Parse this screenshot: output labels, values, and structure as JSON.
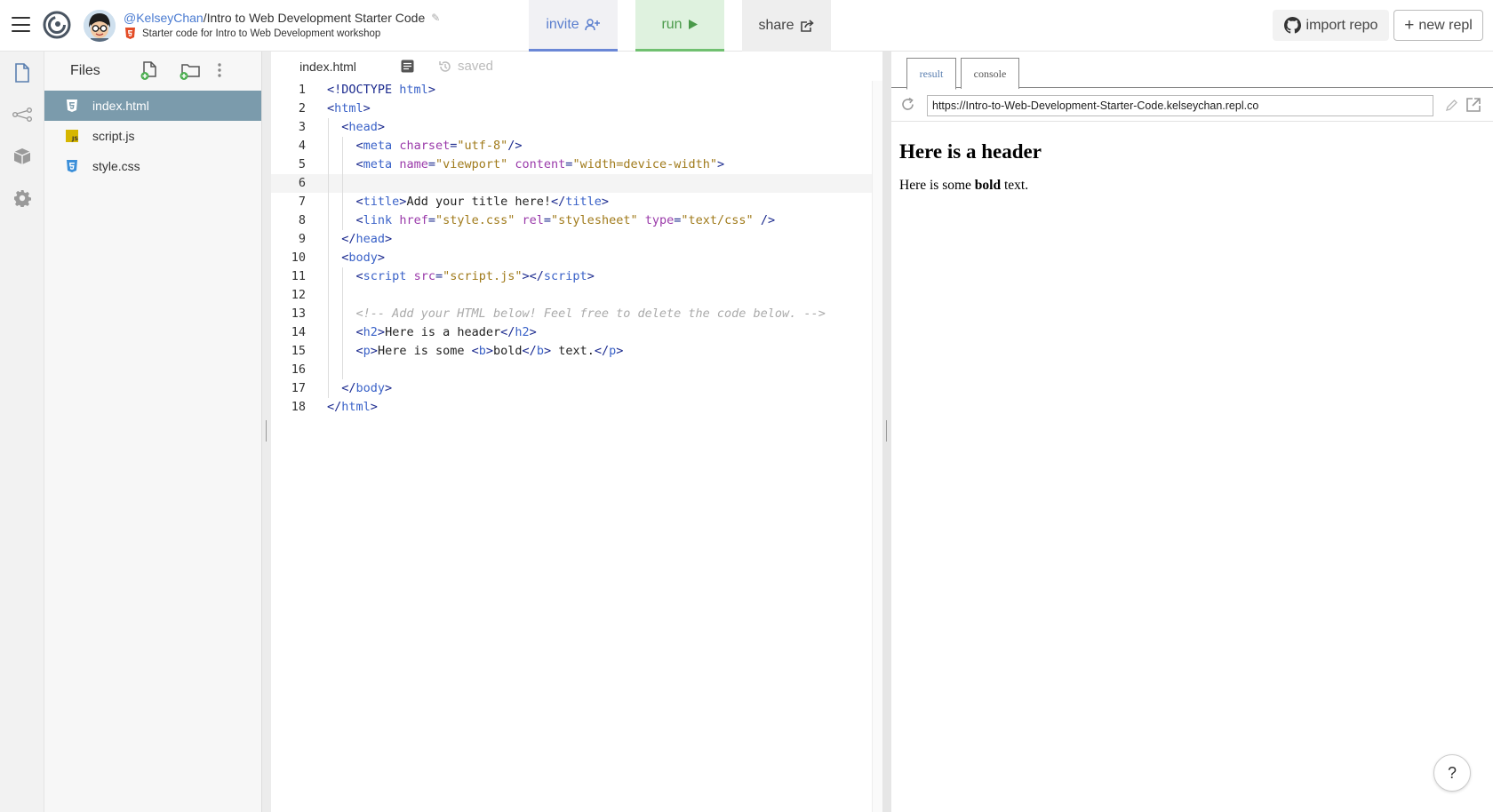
{
  "header": {
    "owner": "@KelseyChan",
    "separator": "/",
    "repl_name": "Intro to Web Development Starter Code",
    "description": "Starter code for Intro to Web Development workshop",
    "invite_label": "invite",
    "run_label": "run",
    "share_label": "share",
    "import_label": "import repo",
    "new_repl_label": "new repl"
  },
  "files_panel": {
    "title": "Files",
    "files": [
      {
        "name": "index.html",
        "icon": "html5-file-icon",
        "active": true
      },
      {
        "name": "script.js",
        "icon": "js-file-icon",
        "active": false
      },
      {
        "name": "style.css",
        "icon": "css3-file-icon",
        "active": false
      }
    ]
  },
  "editor": {
    "tab_label": "index.html",
    "saved_label": "saved",
    "line_numbers": [
      "1",
      "2",
      "3",
      "4",
      "5",
      "6",
      "7",
      "8",
      "9",
      "10",
      "11",
      "12",
      "13",
      "14",
      "15",
      "16",
      "17",
      "18"
    ],
    "current_line": 6
  },
  "result_pane": {
    "tabs": [
      "result",
      "console"
    ],
    "active_tab": "result",
    "url": "https://Intro-to-Web-Development-Starter-Code.kelseychan.repl.co",
    "preview_header": "Here is a header",
    "preview_text_before": "Here is some ",
    "preview_text_bold": "bold",
    "preview_text_after": " text.",
    "help_label": "?"
  },
  "colors": {
    "active_file_bg": "#7b9bac",
    "invite_accent": "#6a87d6",
    "run_accent": "#70c070",
    "run_bg": "#dff2df",
    "tag_color": "#1b2a8e",
    "tag_name_color": "#3a62c8",
    "attr_name_color": "#9a3aaa",
    "attr_value_color": "#a07a1a",
    "comment_color": "#aaaaaa"
  }
}
